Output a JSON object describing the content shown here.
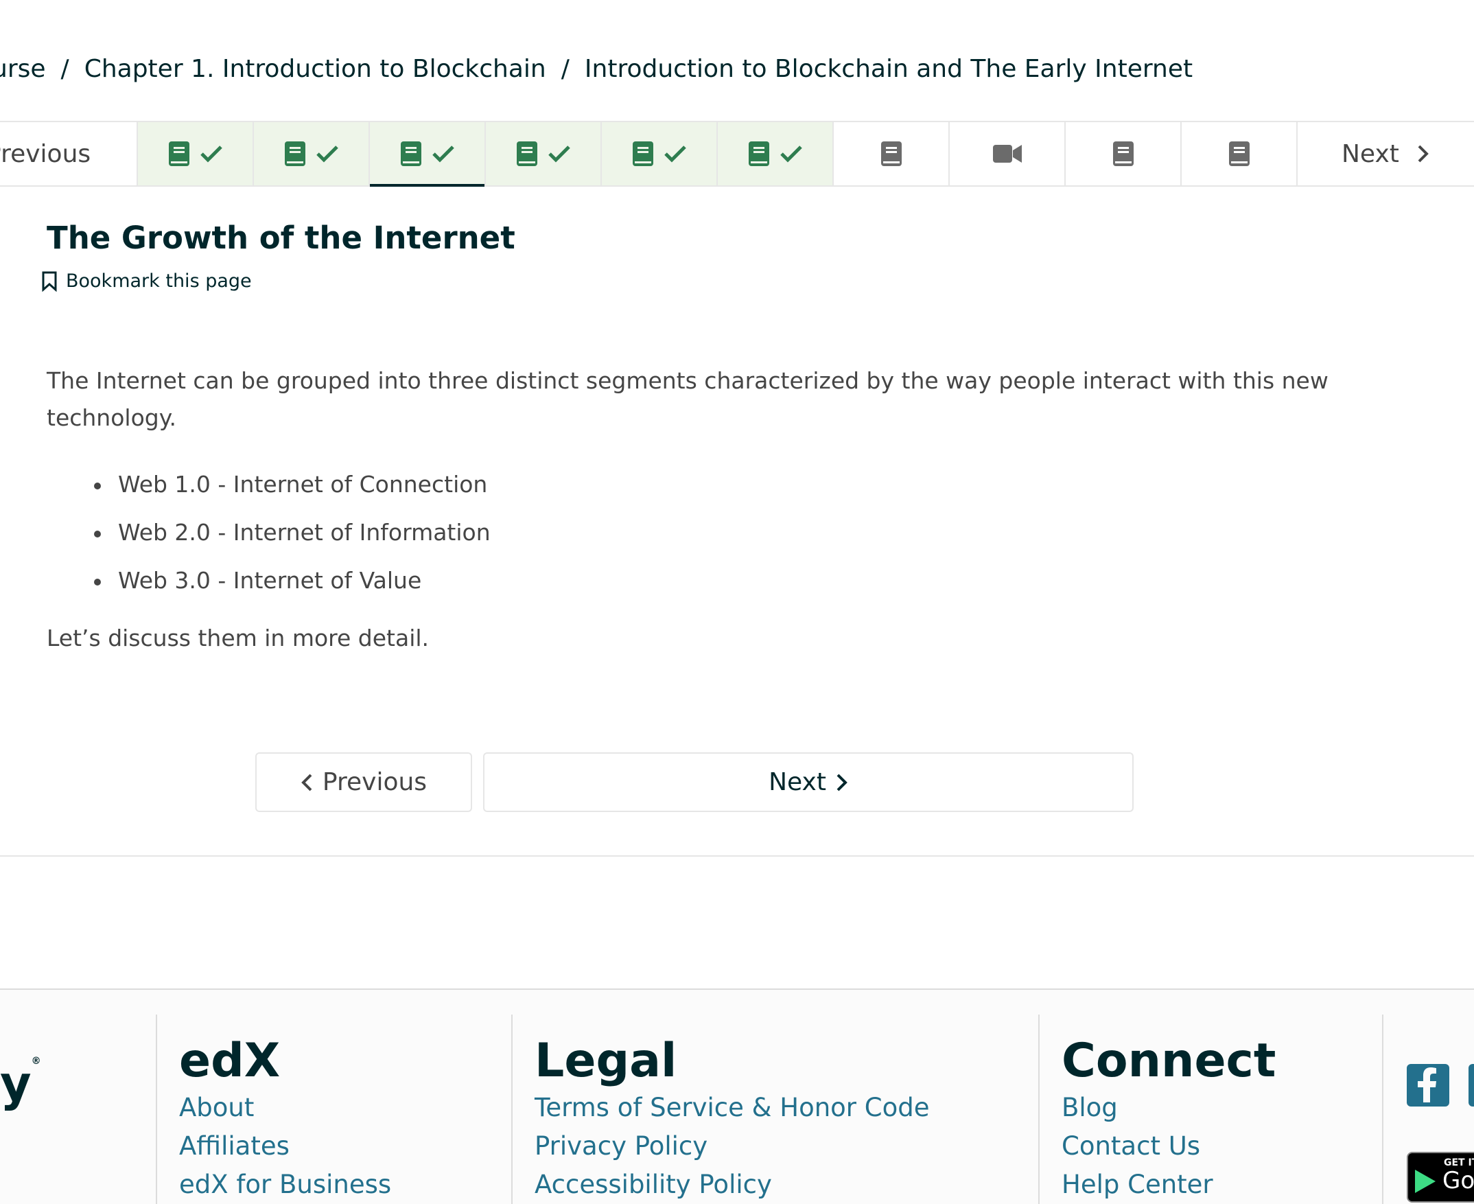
{
  "breadcrumb": {
    "items": [
      "ourse",
      "Chapter 1. Introduction to Blockchain",
      "Introduction to Blockchain and The Early Internet"
    ],
    "separator": "/"
  },
  "sequence_nav": {
    "previous_label": "Previous",
    "next_label": "Next",
    "units": [
      {
        "icon": "book-icon",
        "completed": true
      },
      {
        "icon": "book-icon",
        "completed": true
      },
      {
        "icon": "book-icon",
        "completed": true,
        "active": true
      },
      {
        "icon": "book-icon",
        "completed": true
      },
      {
        "icon": "book-icon",
        "completed": true
      },
      {
        "icon": "book-icon",
        "completed": true
      },
      {
        "icon": "book-icon",
        "completed": false
      },
      {
        "icon": "video-icon",
        "completed": false
      },
      {
        "icon": "book-icon",
        "completed": false
      },
      {
        "icon": "book-icon",
        "completed": false
      }
    ]
  },
  "unit": {
    "title": "The Growth of the Internet",
    "bookmark_label": "Bookmark this page",
    "intro": "The Internet can be grouped into three distinct segments characterized by the way people interact with this new technology.",
    "bullets": [
      "Web 1.0 - Internet of Connection",
      "Web 2.0 - Internet of Information",
      "Web 3.0 - Internet of Value"
    ],
    "outro": "Let’s discuss them in more detail."
  },
  "bottom_nav": {
    "previous_label": "Previous",
    "next_label": "Next"
  },
  "footer": {
    "logo_tail": "y",
    "logo_mark": "®",
    "edx": {
      "heading": "edX",
      "links": [
        "About",
        "Affiliates",
        "edX for Business"
      ]
    },
    "legal": {
      "heading": "Legal",
      "links": [
        "Terms of Service & Honor Code",
        "Privacy Policy",
        "Accessibility Policy"
      ]
    },
    "connect": {
      "heading": "Connect",
      "links": [
        "Blog",
        "Contact Us",
        "Help Center"
      ]
    },
    "app_badge": {
      "small": "GET IT",
      "big": "Goo"
    }
  },
  "colors": {
    "completed_green": "#2e7d4f",
    "completed_bg": "#eef5e9",
    "unvisited_gray": "#6b6b6b",
    "heading": "#00262b",
    "link": "#23708d"
  }
}
